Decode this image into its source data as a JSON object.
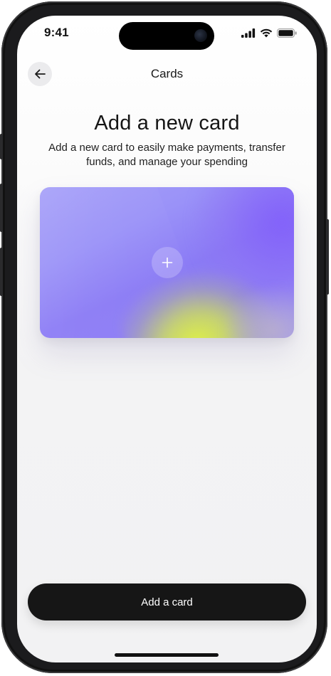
{
  "status_bar": {
    "time": "9:41",
    "icons": [
      "cellular-signal-icon",
      "wifi-icon",
      "battery-icon"
    ]
  },
  "header": {
    "title": "Cards",
    "back_icon": "arrow-left-icon"
  },
  "intro": {
    "title": "Add a new card",
    "subtitle": "Add a new card to easily make payments, transfer funds, and manage your spending"
  },
  "card_placeholder": {
    "icon": "plus-icon"
  },
  "cta": {
    "label": "Add a card"
  },
  "colors": {
    "primary_button": "#161616",
    "card_purple": "#8b7bf5",
    "card_accent_yellow": "#e2f53c",
    "background": "#f2f2f3"
  }
}
